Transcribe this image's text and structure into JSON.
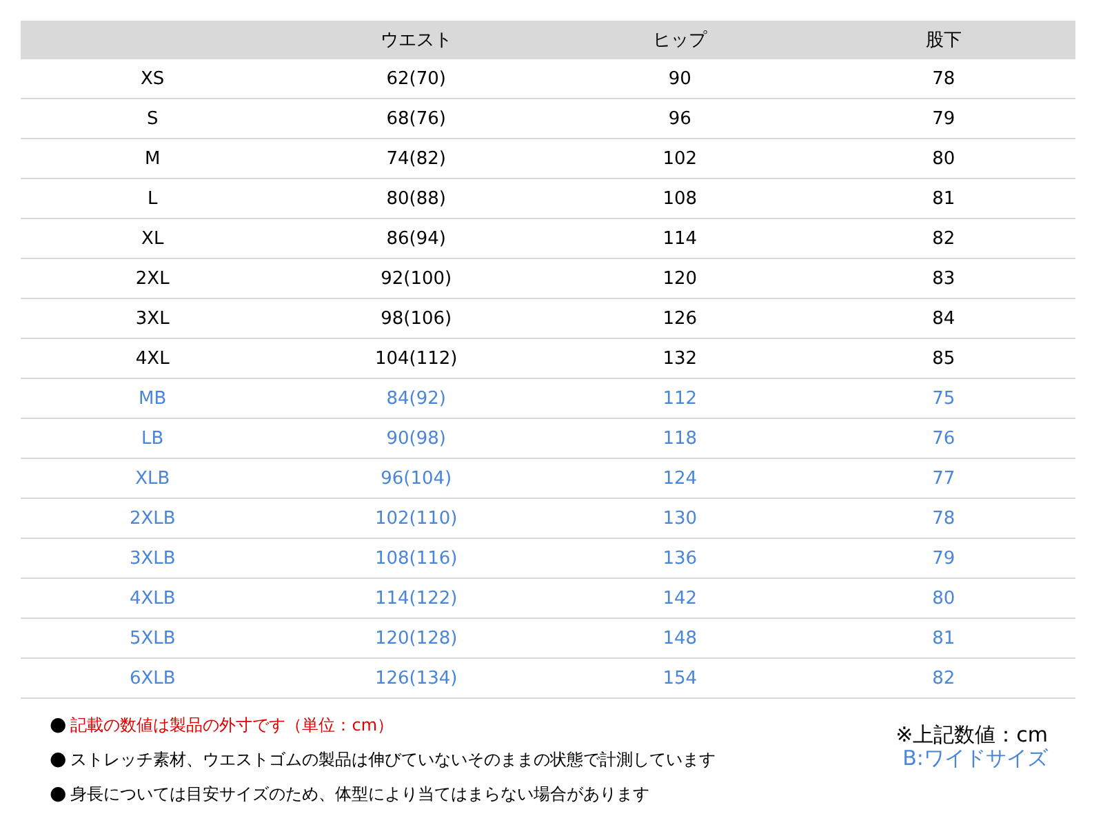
{
  "table": {
    "columns": [
      "",
      "ウエスト",
      "ヒップ",
      "股下"
    ],
    "rows": [
      {
        "cells": [
          "XS",
          "62(70)",
          "90",
          "78"
        ],
        "color": "#000000"
      },
      {
        "cells": [
          "S",
          "68(76)",
          "96",
          "79"
        ],
        "color": "#000000"
      },
      {
        "cells": [
          "M",
          "74(82)",
          "102",
          "80"
        ],
        "color": "#000000"
      },
      {
        "cells": [
          "L",
          "80(88)",
          "108",
          "81"
        ],
        "color": "#000000"
      },
      {
        "cells": [
          "XL",
          "86(94)",
          "114",
          "82"
        ],
        "color": "#000000"
      },
      {
        "cells": [
          "2XL",
          "92(100)",
          "120",
          "83"
        ],
        "color": "#000000"
      },
      {
        "cells": [
          "3XL",
          "98(106)",
          "126",
          "84"
        ],
        "color": "#000000"
      },
      {
        "cells": [
          "4XL",
          "104(112)",
          "132",
          "85"
        ],
        "color": "#000000"
      },
      {
        "cells": [
          "MB",
          "84(92)",
          "112",
          "75"
        ],
        "color": "#4a86d8"
      },
      {
        "cells": [
          "LB",
          "90(98)",
          "118",
          "76"
        ],
        "color": "#4a86d8"
      },
      {
        "cells": [
          "XLB",
          "96(104)",
          "124",
          "77"
        ],
        "color": "#4a86d8"
      },
      {
        "cells": [
          "2XLB",
          "102(110)",
          "130",
          "78"
        ],
        "color": "#4a86d8"
      },
      {
        "cells": [
          "3XLB",
          "108(116)",
          "136",
          "79"
        ],
        "color": "#4a86d8"
      },
      {
        "cells": [
          "4XLB",
          "114(122)",
          "142",
          "80"
        ],
        "color": "#4a86d8"
      },
      {
        "cells": [
          "5XLB",
          "120(128)",
          "148",
          "81"
        ],
        "color": "#4a86d8"
      },
      {
        "cells": [
          "6XLB",
          "126(134)",
          "154",
          "82"
        ],
        "color": "#4a86d8"
      }
    ]
  },
  "notes": [
    {
      "bullet": "●",
      "text": "記載の数値は製品の外寸です（単位：cm）",
      "color": "#e00000"
    },
    {
      "bullet": "●",
      "text": "ストレッチ素材、ウエストゴムの製品は伸びていないそのままの状態で計測しています",
      "color": "#000000"
    },
    {
      "bullet": "●",
      "text": "身長については目安サイズのため、体型により当てはまらない場合があります",
      "color": "#000000"
    }
  ],
  "legend": [
    {
      "text": "※上記数値：cm",
      "color": "#000000"
    },
    {
      "text": "B:ワイドサイズ",
      "color": "#4a86d8"
    }
  ]
}
